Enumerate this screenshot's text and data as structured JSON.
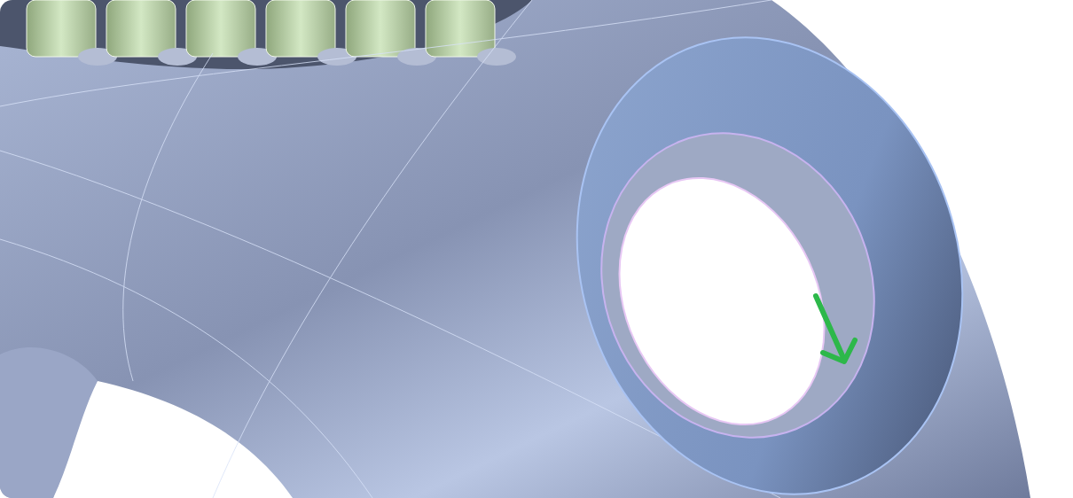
{
  "viewport": {
    "kind": "model-view",
    "direction_arrow": true
  }
}
